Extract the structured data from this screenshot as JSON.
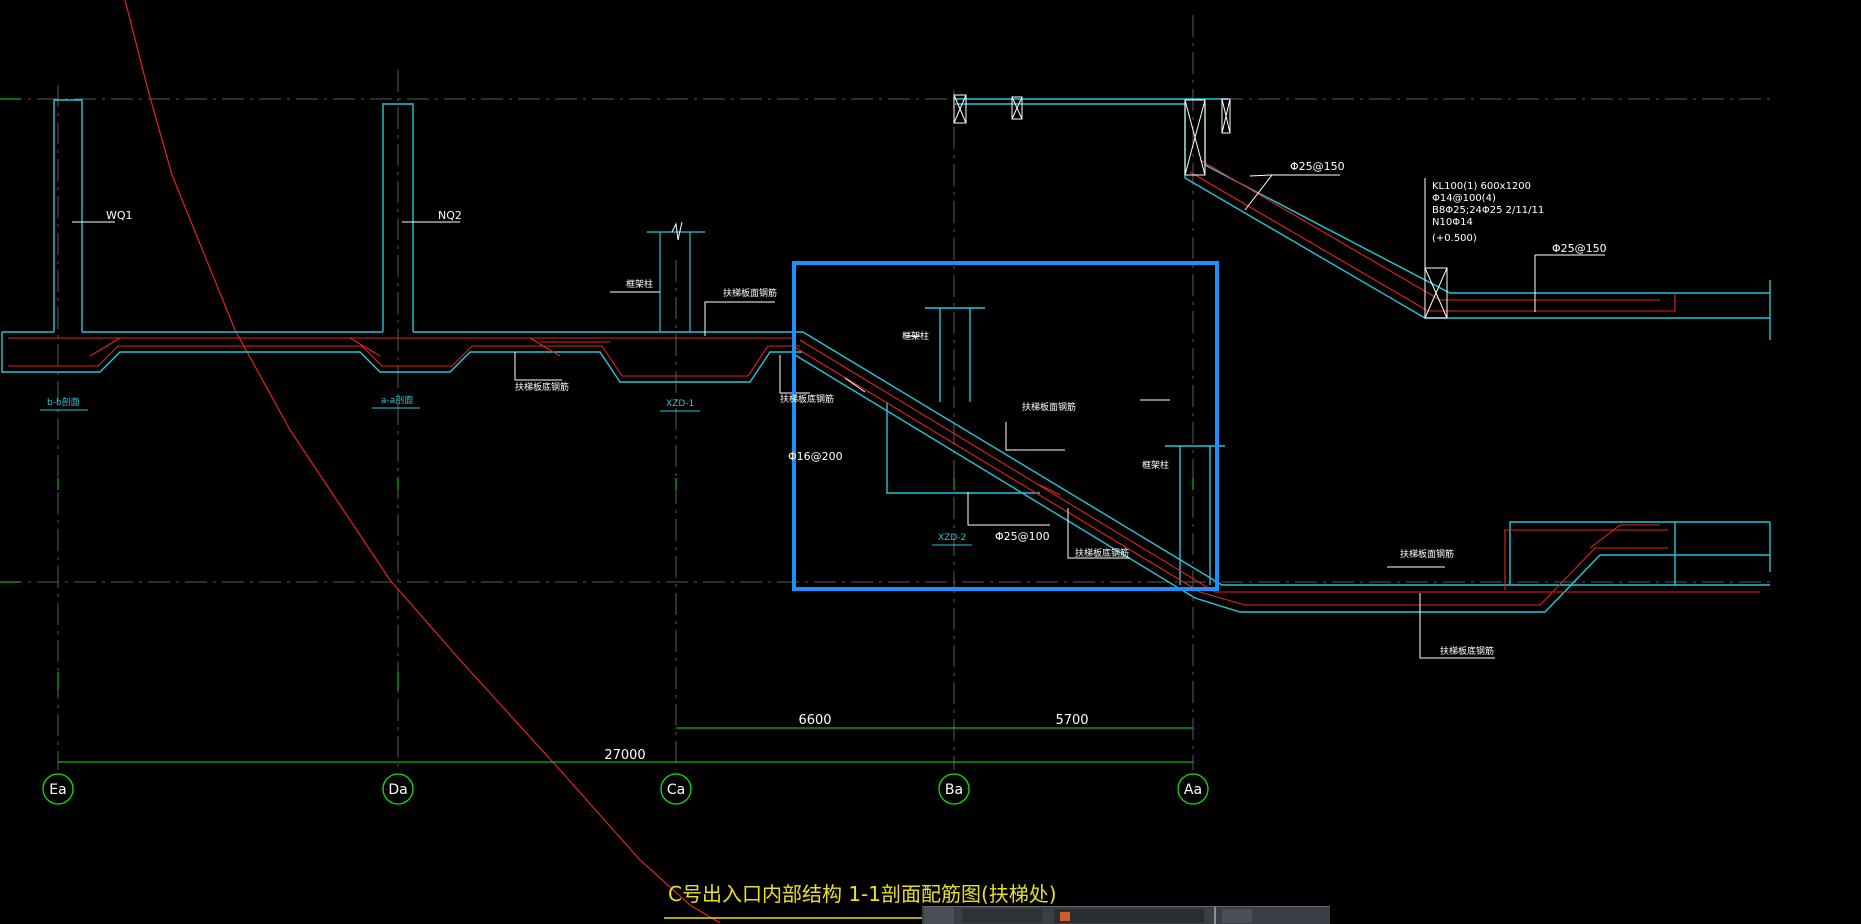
{
  "drawing": {
    "title": "C号出入口内部结构 1-1剖面配筋图(扶梯处)",
    "walls": {
      "w1": "WQ1",
      "w2": "NQ2"
    },
    "section_tags": {
      "b": "b-b剖面",
      "a": "a-a剖面",
      "xzd1": "XZD-1",
      "xzd2": "XZD-2"
    },
    "labels": {
      "column_left": "框架柱",
      "column_mid": "框架柱",
      "column_right": "框架柱",
      "slab_top_left": "扶梯板面钢筋",
      "slab_bottom_left": "扶梯板底钢筋",
      "slab_bottom_mid": "扶梯板底钢筋",
      "slab_top_mid": "扶梯板面钢筋",
      "slab_bottom_incline": "扶梯板底钢筋",
      "slab_top_right": "扶梯板面钢筋",
      "slab_bottom_right": "扶梯板底钢筋"
    },
    "rebar": {
      "r1": "Φ25@150",
      "r2": "Φ25@150",
      "r3": "Φ16@200",
      "r4": "Φ25@100"
    },
    "beam_note": [
      "KL100(1) 600x1200",
      "Φ14@100(4)",
      "B8Φ25;24Φ25 2/11/11",
      "N10Φ14",
      "(+0.500)"
    ]
  },
  "dimensions": {
    "total": "27000",
    "d1": "6600",
    "d2": "5700"
  },
  "axes": [
    "Ea",
    "Da",
    "Ca",
    "Ba",
    "Aa"
  ],
  "colors": {
    "cyan": "#26c6d8",
    "red": "#e2241f",
    "green": "#10e010",
    "white": "#ffffff",
    "yellow": "#e8e020",
    "highlight": "#1e8fff"
  }
}
